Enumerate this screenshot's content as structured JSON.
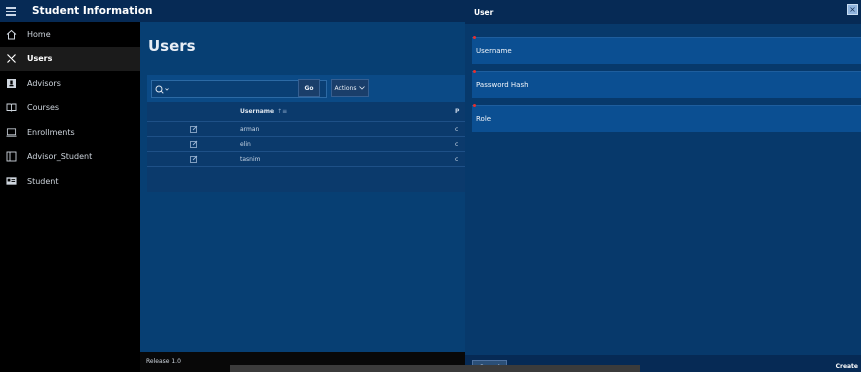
{
  "app": {
    "title": "Student Information"
  },
  "sidebar": {
    "items": [
      {
        "label": "Home",
        "icon": "home-icon"
      },
      {
        "label": "Users",
        "icon": "users-icon",
        "active": true
      },
      {
        "label": "Advisors",
        "icon": "advisor-icon"
      },
      {
        "label": "Courses",
        "icon": "book-icon"
      },
      {
        "label": "Enrollments",
        "icon": "laptop-icon"
      },
      {
        "label": "Advisor_Student",
        "icon": "layout-icon"
      },
      {
        "label": "Student",
        "icon": "id-card-icon"
      }
    ]
  },
  "page": {
    "title": "Users"
  },
  "toolbar": {
    "search_value": "",
    "go_label": "Go",
    "actions_label": "Actions"
  },
  "report": {
    "columns": {
      "username": "Username",
      "sort_indicator": "↑≡",
      "partial": "P"
    },
    "rows": [
      {
        "username": "arman",
        "partial": "c"
      },
      {
        "username": "elin",
        "partial": "c"
      },
      {
        "username": "tasnim",
        "partial": "c"
      }
    ]
  },
  "footer": {
    "release": "Release 1.0"
  },
  "dialog": {
    "title": "User",
    "close_label": "×",
    "fields": [
      {
        "label": "Username"
      },
      {
        "label": "Password Hash"
      },
      {
        "label": "Role"
      }
    ],
    "cancel_label": "Cancel",
    "create_label": "Create"
  },
  "colors": {
    "header": "#062a55",
    "main": "#073f73",
    "field": "#0b4f92",
    "required": "#e23030"
  }
}
